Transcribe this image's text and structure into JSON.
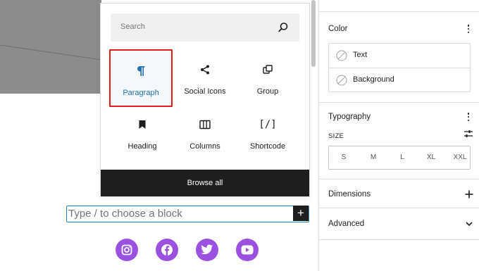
{
  "inserter": {
    "search_placeholder": "Search",
    "blocks": [
      {
        "label": "Paragraph",
        "icon": "paragraph-icon",
        "selected": true
      },
      {
        "label": "Social Icons",
        "icon": "share-icon"
      },
      {
        "label": "Group",
        "icon": "group-icon"
      },
      {
        "label": "Heading",
        "icon": "bookmark-icon"
      },
      {
        "label": "Columns",
        "icon": "columns-icon"
      },
      {
        "label": "Shortcode",
        "icon": "shortcode-icon"
      }
    ],
    "shortcode_glyph": "[/]",
    "browse_all": "Browse all"
  },
  "prompt": {
    "placeholder": "Type / to choose a block",
    "add_symbol": "+"
  },
  "social_icons": [
    "instagram-icon",
    "facebook-icon",
    "twitter-icon",
    "youtube-icon"
  ],
  "sidebar": {
    "color": {
      "title": "Color",
      "items": [
        {
          "label": "Text"
        },
        {
          "label": "Background"
        }
      ]
    },
    "typography": {
      "title": "Typography",
      "size_label": "SIZE",
      "sizes": [
        "S",
        "M",
        "L",
        "XL",
        "XXL"
      ]
    },
    "dimensions": {
      "title": "Dimensions"
    },
    "advanced": {
      "title": "Advanced"
    }
  },
  "colors": {
    "accent": "#2271b1",
    "selection_outline": "#e01c1c",
    "social": "#9b51e0",
    "dark": "#1e1e1e"
  }
}
